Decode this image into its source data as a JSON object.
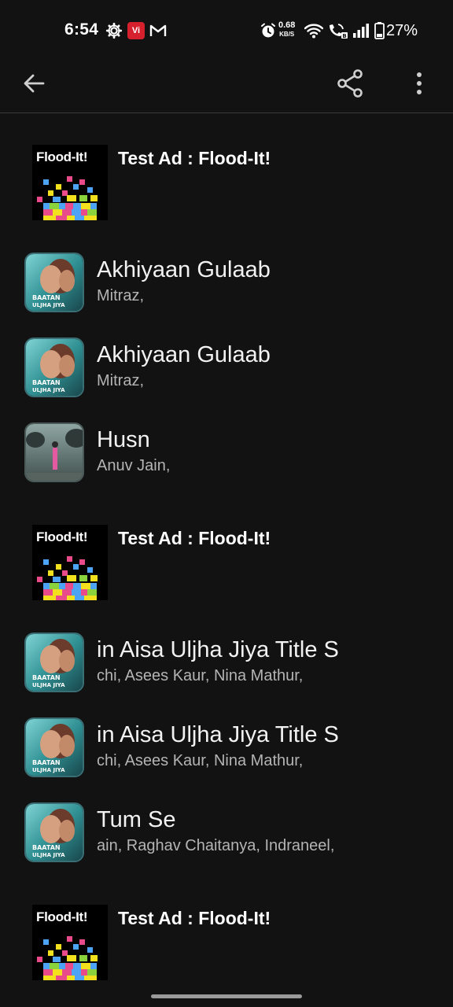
{
  "status_bar": {
    "time": "6:54",
    "carrier_icon_text": "Vi",
    "net_speed_value": "0.68",
    "net_speed_unit": "KB/S",
    "battery": "27%",
    "icons": [
      "settings-gear-icon",
      "vi-app-icon",
      "gmail-icon",
      "alarm-icon",
      "wifi-icon",
      "volte-call-icon",
      "signal-icon",
      "battery-icon"
    ]
  },
  "toolbar": {
    "back_icon": "arrow-left-icon",
    "share_icon": "share-icon",
    "menu_icon": "more-vert-icon"
  },
  "items": [
    {
      "type": "ad",
      "title": "Test Ad : Flood-It!",
      "logo": "Flood-It!"
    },
    {
      "type": "song",
      "title": "Akhiyaan Gulaab",
      "artist": "Mitraz,",
      "art": "teri-baaton-cover"
    },
    {
      "type": "song",
      "title": "Akhiyaan Gulaab",
      "artist": "Mitraz,",
      "art": "teri-baaton-cover"
    },
    {
      "type": "song",
      "title": "Husn",
      "artist": "Anuv Jain,",
      "art": "husn-cover"
    },
    {
      "type": "ad",
      "title": "Test Ad : Flood-It!",
      "logo": "Flood-It!"
    },
    {
      "type": "song",
      "title": "in Aisa Uljha Jiya Title S",
      "artist": "chi, Asees Kaur, Nina Mathur,",
      "art": "teri-baaton-cover"
    },
    {
      "type": "song",
      "title": "in Aisa Uljha Jiya Title S",
      "artist": "chi, Asees Kaur, Nina Mathur,",
      "art": "teri-baaton-cover"
    },
    {
      "type": "song",
      "title": "Tum Se",
      "artist": "ain, Raghav Chaitanya, Indraneel,",
      "art": "teri-baaton-cover"
    },
    {
      "type": "ad",
      "title": "Test Ad : Flood-It!",
      "logo": "Flood-It!"
    }
  ],
  "colors": {
    "background": "#121212",
    "primary_text": "#f2f2f2",
    "secondary_text": "#b4b4b4",
    "carrier_red": "#d6202e"
  }
}
